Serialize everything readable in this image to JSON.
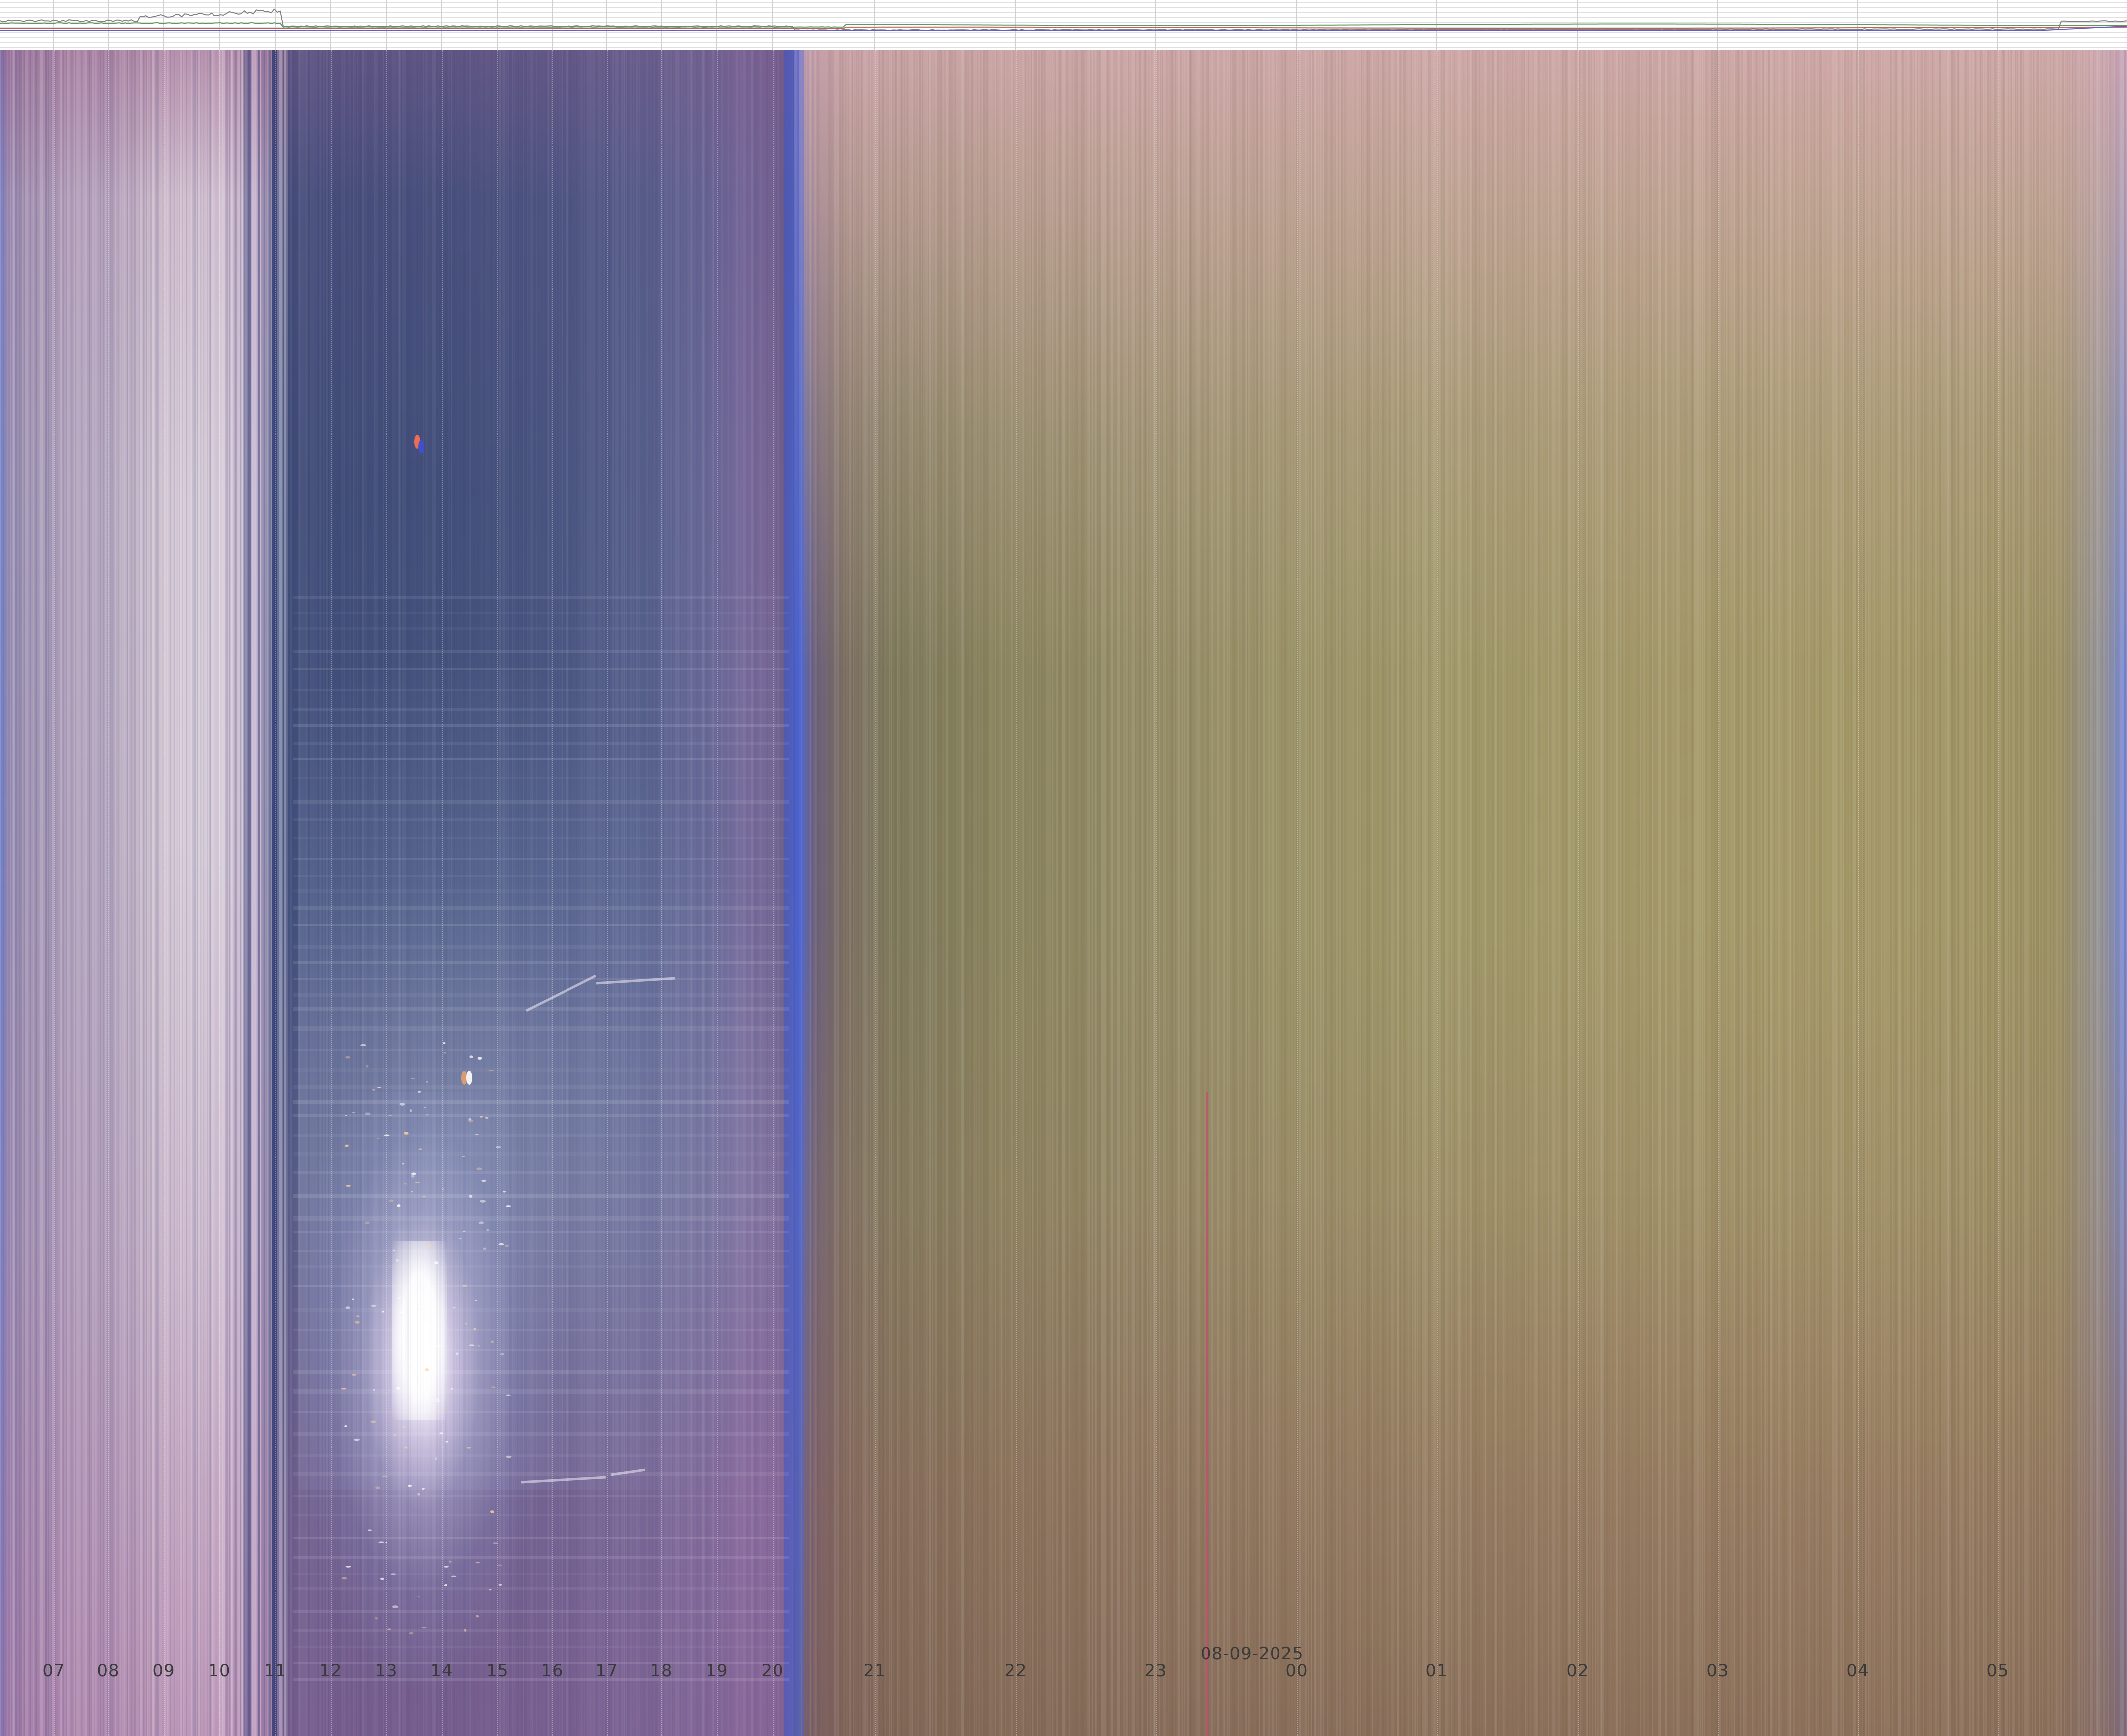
{
  "date_label": "08-09-2025",
  "hour_labels": [
    "07",
    "08",
    "09",
    "10",
    "11",
    "12",
    "13",
    "14",
    "15",
    "16",
    "17",
    "18",
    "19",
    "20",
    "21",
    "22",
    "23",
    "00",
    "01",
    "02",
    "03",
    "04",
    "05"
  ],
  "colors": {
    "day_sky": "#d9ccd8",
    "twilight_sky": "#414d79",
    "night_sky": "#a09869",
    "edge_blue": "#6f86d6",
    "axis_text": "#3a3a3a",
    "sensor_green": "#5a9a5a",
    "sensor_red": "#c06060",
    "sensor_blue": "#6060c0",
    "sensor_gray": "#808080"
  }
}
